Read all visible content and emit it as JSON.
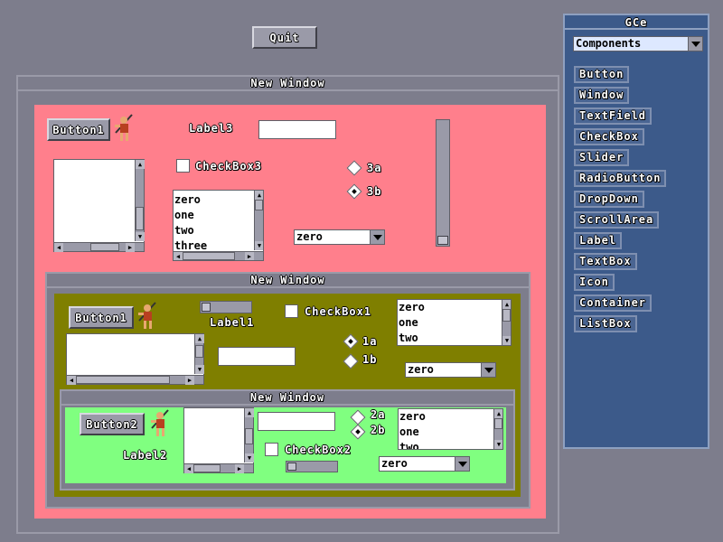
{
  "toolbar": {
    "quit_label": "Quit"
  },
  "colors": {
    "desktop": "#7d7d8c",
    "pink": "#ff7f8c",
    "olive": "#7f7f00",
    "green": "#80ff80",
    "gce_bg": "#3c5a8a"
  },
  "gce": {
    "title": "GCe",
    "category": "Components",
    "items": [
      "Button",
      "Window",
      "TextField",
      "CheckBox",
      "Slider",
      "RadioButton",
      "DropDown",
      "ScrollArea",
      "Label",
      "TextBox",
      "Icon",
      "Container",
      "ListBox"
    ]
  },
  "window1": {
    "title": "New Window",
    "button": "Button1",
    "label": "Label3",
    "checkbox": "CheckBox3",
    "radio_a": "3a",
    "radio_b": "3b",
    "list": [
      "zero",
      "one",
      "two",
      "three"
    ],
    "dropdown": "zero"
  },
  "window2": {
    "title": "New Window",
    "button": "Button1",
    "label": "Label1",
    "checkbox": "CheckBox1",
    "radio_a": "1a",
    "radio_b": "1b",
    "list": [
      "zero",
      "one",
      "two"
    ],
    "dropdown": "zero"
  },
  "window3": {
    "title": "New Window",
    "button": "Button2",
    "label": "Label2",
    "checkbox": "CheckBox2",
    "radio_a": "2a",
    "radio_b": "2b",
    "list": [
      "zero",
      "one",
      "two"
    ],
    "dropdown": "zero"
  }
}
